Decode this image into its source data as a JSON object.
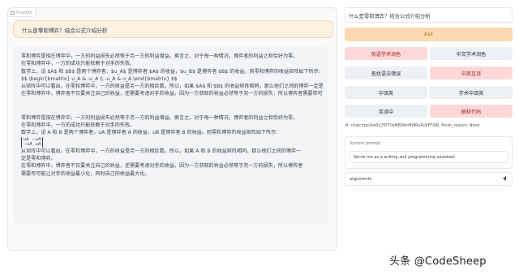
{
  "chatbot": {
    "label": "Chatbot",
    "user_message": "什么是零和博弈？结合公式介绍分析",
    "bot_block1": [
      "零和博弈是指在博弈中，一方的利益损失必然等于另一方的利益增益。换言之，对于每一种情况，博弈者的利益之和恰好为零。",
      "在零和博弈中，一方的成功只能依赖于对手的失败。",
      "数学上，设 $A$ 和 $B$ 是两个博弈者，$u_A$ 是博弈者 $A$ 的收益，$u_B$ 是博弈者 $B$ 的收益。则零和博弈的收益矩阵如下所示：",
      "$$ \\begin{bmatrix} u_A & -u_A \\\\ -u_A & u_A \\end{bmatrix} $$",
      "从矩阵中可以看出，在零和博弈中，一方的收益是另一方的相反数。所以，如果 $A$ 和 $B$ 的收益矩阵相同，那么他们之间的博弈一定是零和博弈。",
      "在零和博弈中，博弈者不仅要关注自己的收益，还需要考虑对手的收益。因为一方获取的收益必然等于另一方的损失，所以博弈者需要尽可能让对手的收益最小化，同时自己的收益最大化。"
    ],
    "bot_block2": {
      "line1": "零和博弈是指在博弈中，一方的利益损失必然等于另一方的利益增益。换言之，对于每一种情况，博弈者的利益之和恰好为零。",
      "line2": "在零和博弈中，一方的成功只能依赖于对手的失败。",
      "line3": "数学上，设 A 和 B 是两个博弈者，uA 是博弈者 A 的收益，uB 是博弈者 B 的收益。则零和博弈的收益矩阵如下所示：",
      "matrix": [
        [
          "uA",
          "−uA"
        ],
        [
          "−uA",
          "uA"
        ]
      ],
      "line4": "从矩阵中可以看出，在零和博弈中，一方的收益是另一方的相反数。所以，如果 A 和 B 的收益矩阵相同，那么他们之间的博弈一",
      "line5": "定是零和博弈。",
      "line6": "在零和博弈中，博弈者不仅要关注自己的收益，还需要考虑对手的收益。因为一方获取的收益必然等于另一方的损失，所以博弈者",
      "line7": "需要尽可能让对手的收益最小化，同时自己的收益最大化。"
    }
  },
  "sidebar": {
    "query_value": "什么是零和博弈？结合公式介绍分析",
    "ask_label": "Ask",
    "buttons": [
      {
        "label": "英语学术润色",
        "style": "red"
      },
      {
        "label": "中文学术润色",
        "style": "gray"
      },
      {
        "label": "查找语法错误",
        "style": "gray"
      },
      {
        "label": "中英互译",
        "style": "red"
      },
      {
        "label": "中译英",
        "style": "gray"
      },
      {
        "label": "学术中译英",
        "style": "gray"
      },
      {
        "label": "英译中",
        "style": "gray"
      },
      {
        "label": "解释代码",
        "style": "red"
      }
    ],
    "status": "id: chatcmpl-6w0o7KYTIwM89lbrMWRu4UkFFXIR, finish_reason: None",
    "system_prompt_label": "System prompt",
    "system_prompt_value": "Serve me as a writing and programming assistant.",
    "arguments_label": "arguments"
  },
  "watermark": "头条 @CodeSheep",
  "colors": {
    "accent_orange": "#fcd9b0",
    "user_bubble": "#fdf1e2",
    "button_red": "#fdd8d8",
    "button_gray": "#eceff3"
  }
}
